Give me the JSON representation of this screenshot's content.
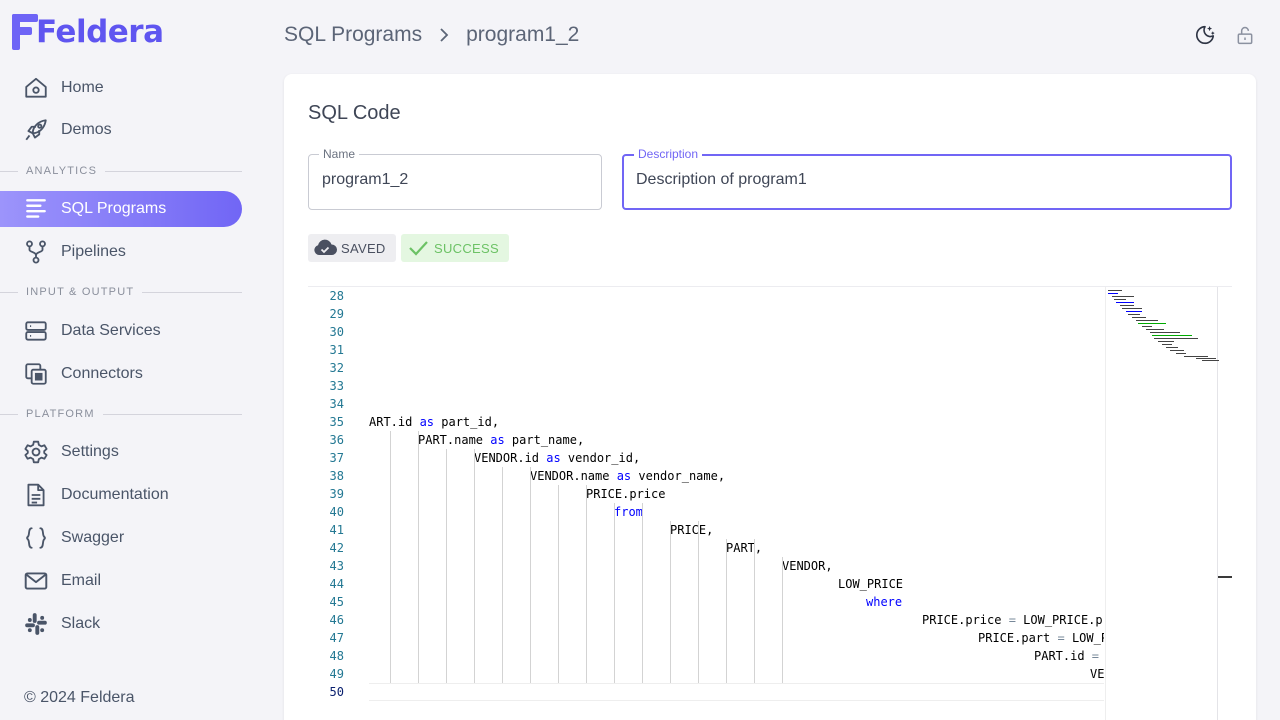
{
  "brand": {
    "name": "Feldera",
    "color": "#6e64f6"
  },
  "sidebar": {
    "items": [
      {
        "label": "Home",
        "icon": "home-icon"
      },
      {
        "label": "Demos",
        "icon": "rocket-icon"
      },
      {
        "label": "SQL Programs",
        "icon": "lines-icon"
      },
      {
        "label": "Pipelines",
        "icon": "branch-icon"
      },
      {
        "label": "Data Services",
        "icon": "server-icon"
      },
      {
        "label": "Connectors",
        "icon": "copy-icon"
      },
      {
        "label": "Settings",
        "icon": "gear-icon"
      },
      {
        "label": "Documentation",
        "icon": "document-icon"
      },
      {
        "label": "Swagger",
        "icon": "braces-icon"
      },
      {
        "label": "Email",
        "icon": "mail-icon"
      },
      {
        "label": "Slack",
        "icon": "slack-icon"
      }
    ],
    "sections": [
      "ANALYTICS",
      "INPUT & OUTPUT",
      "PLATFORM"
    ],
    "active": "SQL Programs",
    "footer": "© 2024 Feldera"
  },
  "header": {
    "breadcrumb": [
      "SQL Programs",
      "program1_2"
    ],
    "icons": [
      "moon-star-icon",
      "lock-open-icon"
    ]
  },
  "main": {
    "title": "SQL Code",
    "name_field": {
      "label": "Name",
      "value": "program1_2"
    },
    "description_field": {
      "label": "Description",
      "value": "Description of program1"
    },
    "status_chips": [
      {
        "label": "SAVED",
        "icon": "cloud-check-icon"
      },
      {
        "label": "SUCCESS",
        "icon": "check-icon"
      }
    ]
  },
  "editor": {
    "line_numbers": [
      "28",
      "29",
      "30",
      "31",
      "32",
      "33",
      "34",
      "35",
      "36",
      "37",
      "38",
      "39",
      "40",
      "41",
      "42",
      "43",
      "44",
      "45",
      "46",
      "47",
      "48",
      "49",
      "50"
    ],
    "current_line": "50",
    "lines": {
      "l35": [
        "ART.id ",
        "as",
        " part_id,"
      ],
      "l36": [
        "PART.name ",
        "as",
        " part_name,"
      ],
      "l37": [
        "VENDOR.id ",
        "as",
        " vendor_id,"
      ],
      "l38": [
        "VENDOR.name ",
        "as",
        " vendor_name,"
      ],
      "l39": "PRICE.price",
      "l40": "from",
      "l41": "PRICE,",
      "l42": "PART,",
      "l43": "VENDOR,",
      "l44": "LOW_PRICE",
      "l45": "where",
      "l46": [
        "PRICE.price ",
        "=",
        " LOW_PRICE.pr"
      ],
      "l47": [
        "PRICE.part ",
        "=",
        " LOW_P"
      ],
      "l48": [
        "PART.id ",
        "=",
        " "
      ],
      "l49": "VE"
    },
    "colors": {
      "keyword": "#0000ff",
      "line_number": "#237893",
      "accent": "#7166f5",
      "success": "#6cc265"
    }
  }
}
